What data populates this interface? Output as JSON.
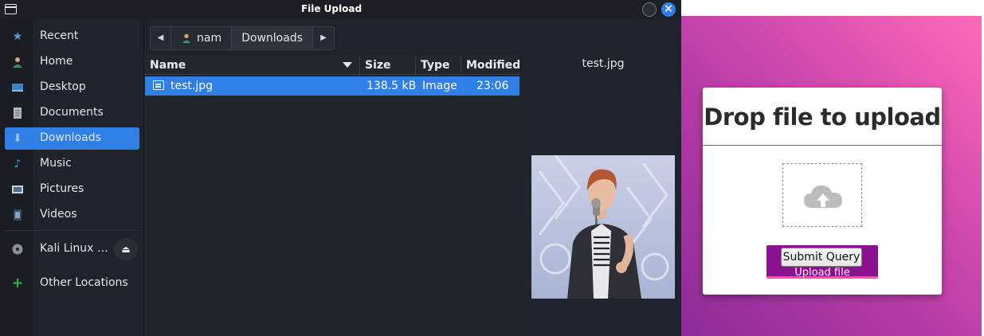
{
  "window": {
    "title": "File Upload"
  },
  "sidebar": {
    "items": [
      {
        "label": "Recent",
        "icon": "recent-icon"
      },
      {
        "label": "Home",
        "icon": "home-icon"
      },
      {
        "label": "Desktop",
        "icon": "desktop-icon"
      },
      {
        "label": "Documents",
        "icon": "documents-icon"
      },
      {
        "label": "Downloads",
        "icon": "downloads-icon",
        "active": true
      },
      {
        "label": "Music",
        "icon": "music-icon"
      },
      {
        "label": "Pictures",
        "icon": "pictures-icon"
      },
      {
        "label": "Videos",
        "icon": "videos-icon"
      },
      {
        "label": "Kali Linux …",
        "icon": "disc-icon"
      },
      {
        "label": "Other Locations",
        "icon": "plus-icon"
      }
    ]
  },
  "pathbar": {
    "segments": [
      "nam",
      "Downloads"
    ]
  },
  "filelist": {
    "columns": [
      "Name",
      "Size",
      "Type",
      "Modified"
    ],
    "rows": [
      {
        "name": "test.jpg",
        "size": "138.5 kB",
        "type": "Image",
        "modified": "23:06"
      }
    ]
  },
  "preview": {
    "filename": "test.jpg"
  },
  "webpage": {
    "title": "Drop file to upload",
    "submit_label": "Submit Query",
    "upload_label": "Upload file",
    "accent_color": "#8a128e"
  }
}
